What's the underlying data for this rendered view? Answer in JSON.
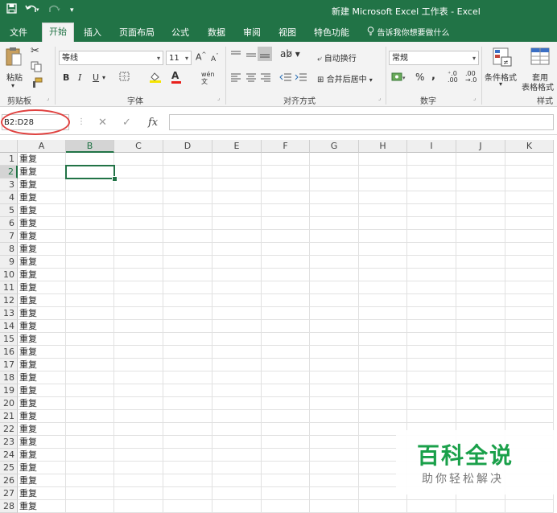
{
  "titlebar": {
    "title": "新建 Microsoft Excel 工作表 - Excel",
    "save_icon": "save-icon",
    "undo_icon": "undo-icon",
    "redo_icon": "redo-icon"
  },
  "tabs": [
    "文件",
    "开始",
    "插入",
    "页面布局",
    "公式",
    "数据",
    "审阅",
    "视图",
    "特色功能"
  ],
  "tell_me": "告诉我你想要做什么",
  "ribbon": {
    "clipboard": {
      "paste": "粘贴",
      "label": "剪贴板"
    },
    "font": {
      "name": "等线",
      "size": "11",
      "grow": "A",
      "shrink": "A",
      "bold": "B",
      "italic": "I",
      "underline": "U",
      "wen": "wén",
      "label": "字体"
    },
    "alignment": {
      "wrap": "自动换行",
      "merge": "合并后居中",
      "label": "对齐方式"
    },
    "number": {
      "format": "常规",
      "percent": "%",
      "comma": ",",
      "label": "数字"
    },
    "styles": {
      "conditional": "条件格式",
      "table_a": "套用",
      "table_b": "表格格式",
      "label": "样式"
    }
  },
  "formula_bar": {
    "name_box": "B2:D28",
    "fx": "fx",
    "cancel": "✕",
    "confirm": "✓",
    "content": ""
  },
  "columns": [
    "A",
    "B",
    "C",
    "D",
    "E",
    "F",
    "G",
    "H",
    "I",
    "J",
    "K"
  ],
  "rows": [
    "1",
    "2",
    "3",
    "4",
    "5",
    "6",
    "7",
    "8",
    "9",
    "10",
    "11",
    "12",
    "13",
    "14",
    "15",
    "16",
    "17",
    "18",
    "19",
    "20",
    "21",
    "22",
    "23",
    "24",
    "25",
    "26",
    "27",
    "28"
  ],
  "cell_value": "重复",
  "watermark": {
    "title": "百科全说",
    "subtitle": "助你轻松解决"
  },
  "colors": {
    "excel_green": "#217346",
    "annotation_red": "#e0413f",
    "watermark_green": "#1aa04a"
  }
}
